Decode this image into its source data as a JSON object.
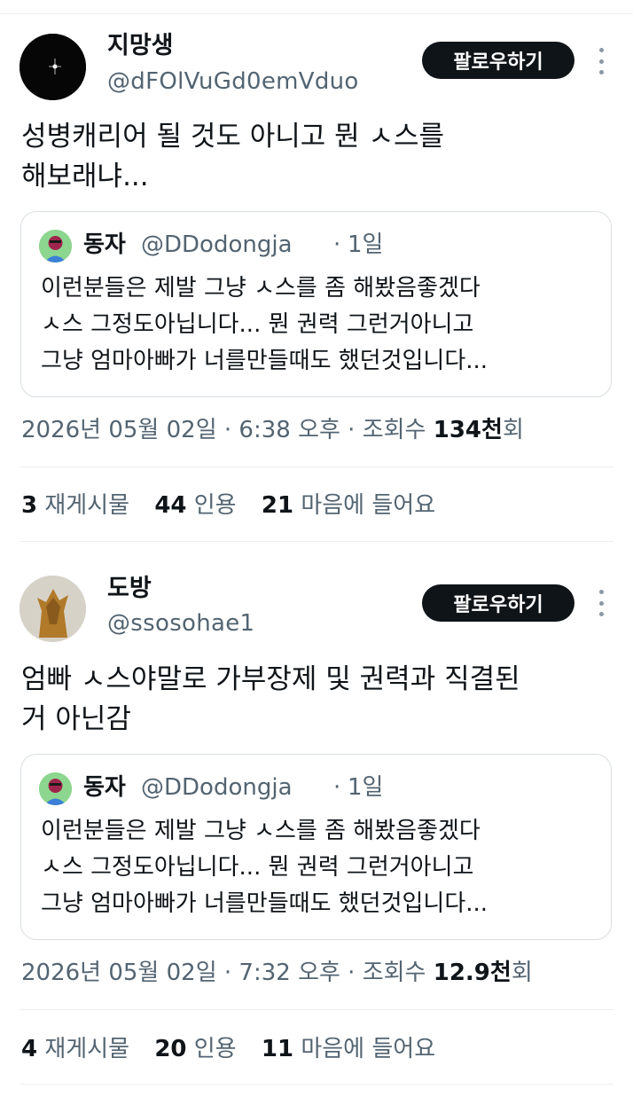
{
  "tweets": [
    {
      "display_name": "지망생",
      "handle": "@dFOlVuGd0emVduo",
      "follow_label": "팔로우하기",
      "text": "성병캐리어 될 것도 아니고 뭔 ㅅ스를\n해보래냐...",
      "quote": {
        "name": "동자",
        "handle": "@DDodongja",
        "dot": "·",
        "time": "1일",
        "text": "이런분들은 제발 그냥 ㅅ스를 좀 해봤음좋겠다\nㅅ스 그정도아닙니다... 뭔 권력 그런거아니고\n그냥 엄마아빠가 너를만들때도 했던것입니다..."
      },
      "date": "2026년 05월 02일 · 6:38 오후 · 조회수",
      "views_num": "134천",
      "views_unit": "회",
      "stats": {
        "retweets_num": "3",
        "retweets_label": "재게시물",
        "quotes_num": "44",
        "quotes_label": "인용",
        "likes_num": "21",
        "likes_label": "마음에 들어요"
      }
    },
    {
      "display_name": "도방",
      "handle": "@ssosohae1",
      "follow_label": "팔로우하기",
      "text": "엄빠 ㅅ스야말로 가부장제 및 권력과 직결된\n거 아닌감",
      "quote": {
        "name": "동자",
        "handle": "@DDodongja",
        "dot": "·",
        "time": "1일",
        "text": "이런분들은 제발 그냥 ㅅ스를 좀 해봤음좋겠다\nㅅ스 그정도아닙니다... 뭔 권력 그런거아니고\n그냥 엄마아빠가 너를만들때도 했던것입니다..."
      },
      "date": "2026년 05월 02일 · 7:32 오후 · 조회수",
      "views_num": "12.9천",
      "views_unit": "회",
      "stats": {
        "retweets_num": "4",
        "retweets_label": "재게시물",
        "quotes_num": "20",
        "quotes_label": "인용",
        "likes_num": "11",
        "likes_label": "마음에 들어요"
      }
    }
  ]
}
